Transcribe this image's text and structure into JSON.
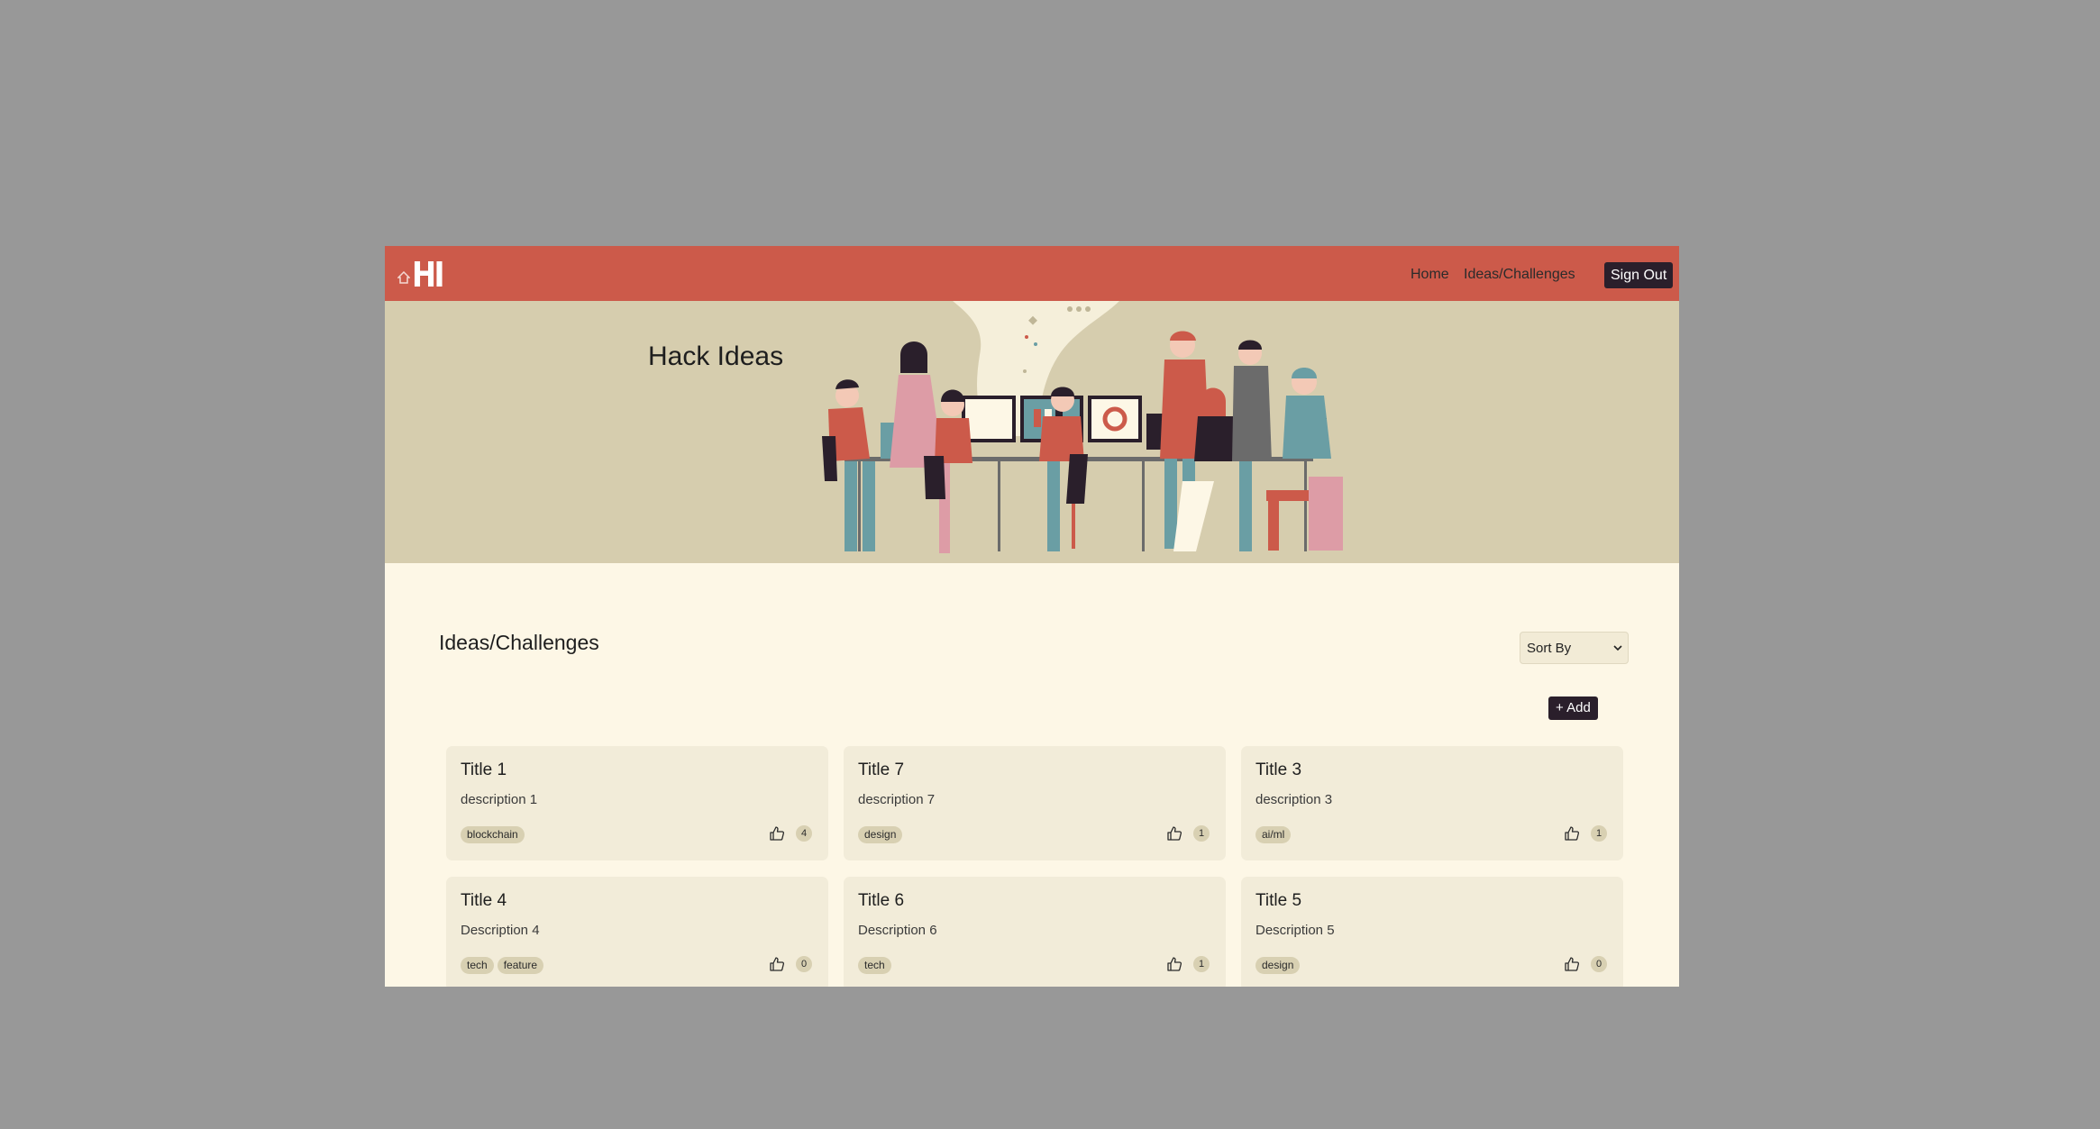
{
  "nav": {
    "logo_text": "HI",
    "home": "Home",
    "ideas": "Ideas/Challenges",
    "sign_out": "Sign Out"
  },
  "hero": {
    "title": "Hack Ideas"
  },
  "main": {
    "section_title": "Ideas/Challenges",
    "sort_label": "Sort By",
    "add_label": "+ Add"
  },
  "ideas": [
    {
      "title": "Title 1",
      "description": "description 1",
      "tags": [
        "blockchain"
      ],
      "likes": "4"
    },
    {
      "title": "Title 7",
      "description": "description 7",
      "tags": [
        "design"
      ],
      "likes": "1"
    },
    {
      "title": "Title 3",
      "description": "description 3",
      "tags": [
        "ai/ml"
      ],
      "likes": "1"
    },
    {
      "title": "Title 4",
      "description": "Description 4",
      "tags": [
        "tech",
        "feature"
      ],
      "likes": "0"
    },
    {
      "title": "Title 6",
      "description": "Description 6",
      "tags": [
        "tech"
      ],
      "likes": "1"
    },
    {
      "title": "Title 5",
      "description": "Description 5",
      "tags": [
        "design"
      ],
      "likes": "0"
    }
  ],
  "colors": {
    "navbar": "#cc5a4a",
    "hero": "#d6cdae",
    "background": "#fdf7e6",
    "card": "#f2ecd9",
    "dark_button": "#2a1f2b"
  }
}
